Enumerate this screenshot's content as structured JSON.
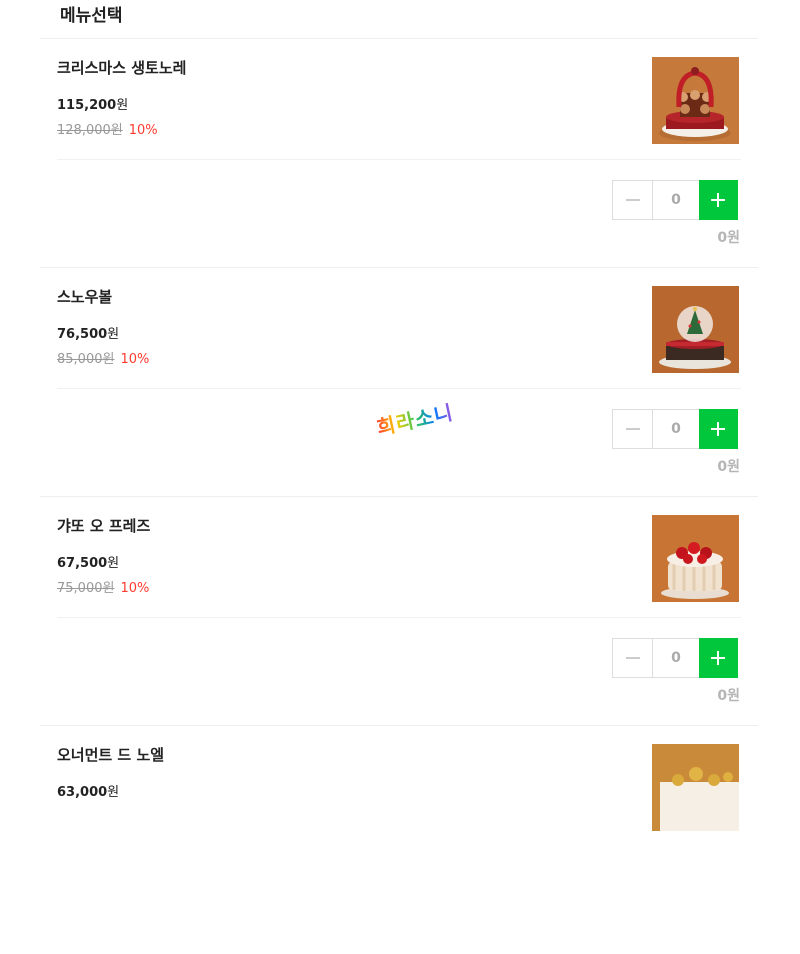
{
  "section": {
    "title": "메뉴선택"
  },
  "items": [
    {
      "name": "크리스마스 생토노레",
      "price": "115,200",
      "unit": "원",
      "original_price": "128,000원",
      "discount": "10%",
      "quantity": "0",
      "subtotal": "0원"
    },
    {
      "name": "스노우볼",
      "price": "76,500",
      "unit": "원",
      "original_price": "85,000원",
      "discount": "10%",
      "quantity": "0",
      "subtotal": "0원"
    },
    {
      "name": "갸또 오 프레즈",
      "price": "67,500",
      "unit": "원",
      "original_price": "75,000원",
      "discount": "10%",
      "quantity": "0",
      "subtotal": "0원"
    },
    {
      "name": "오너먼트 드 노엘",
      "price": "63,000",
      "unit": "원"
    }
  ],
  "watermark": "희라소니",
  "colors": {
    "accent_green": "#00c73c",
    "discount_red": "#ff3b30",
    "image_bg": "#c57a3c"
  }
}
